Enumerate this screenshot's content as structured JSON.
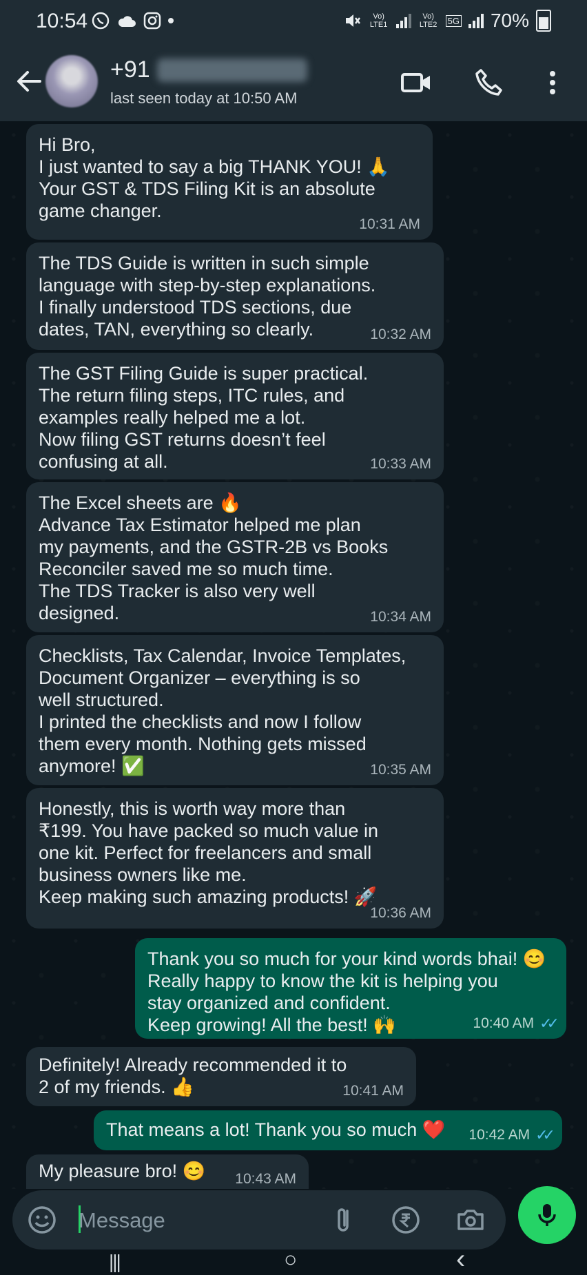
{
  "status_bar": {
    "time": "10:54",
    "battery": "70%",
    "sim1": "Vo) LTE1",
    "sim2": "Vo) LTE2",
    "network": "5G"
  },
  "header": {
    "contact_prefix": "+91",
    "last_seen": "last seen today at 10:50 AM",
    "icons": [
      "back-arrow-icon",
      "video-call-icon",
      "voice-call-icon",
      "more-options-icon"
    ]
  },
  "messages": [
    {
      "dir": "in",
      "text": "Hi Bro,\nI just wanted to say a big THANK YOU! 🙏\nYour GST & TDS Filing Kit is an absolute\ngame changer.",
      "time": "10:31 AM"
    },
    {
      "dir": "in",
      "text": "The TDS Guide is written in such simple\nlanguage with step-by-step explanations.\nI finally understood TDS sections, due\ndates, TAN, everything so clearly.",
      "time": "10:32 AM"
    },
    {
      "dir": "in",
      "text": "The GST Filing Guide is super practical.\nThe return filing steps, ITC rules, and\nexamples really helped me a lot.\nNow filing GST returns doesn’t feel\nconfusing at all.",
      "time": "10:33 AM"
    },
    {
      "dir": "in",
      "text": "The Excel sheets are 🔥\nAdvance Tax Estimator helped me plan\nmy payments, and the GSTR-2B vs Books\nReconciler saved me so much time.\nThe TDS Tracker is also very well\ndesigned.",
      "time": "10:34 AM"
    },
    {
      "dir": "in",
      "text": "Checklists, Tax Calendar, Invoice Templates,\nDocument Organizer – everything is so\nwell structured.\nI printed the checklists and now I follow\nthem every month. Nothing gets missed\nanymore! ✅",
      "time": "10:35 AM"
    },
    {
      "dir": "in",
      "text": "Honestly, this is worth way more than\n₹199. You have packed so much value in\none kit. Perfect for freelancers and small\nbusiness owners like me.\nKeep making such amazing products! 🚀",
      "time": "10:36 AM"
    },
    {
      "dir": "out",
      "text": "Thank you so much for your kind words bhai! 😊\nReally happy to know the kit is helping you\nstay organized and confident.\nKeep growing! All the best! 🙌",
      "time": "10:40 AM",
      "read": true
    },
    {
      "dir": "in",
      "text": "Definitely! Already recommended it to\n2 of my friends. 👍",
      "time": "10:41 AM"
    },
    {
      "dir": "out",
      "text": "That means a lot! Thank you so much ❤️",
      "time": "10:42 AM",
      "read": true
    },
    {
      "dir": "in",
      "text": "My pleasure bro! 😊",
      "time": "10:43 AM"
    }
  ],
  "composer": {
    "placeholder": "Message",
    "icons": [
      "emoji-icon",
      "attach-icon",
      "rupee-payment-icon",
      "camera-icon",
      "mic-icon"
    ]
  },
  "nav_bar": {
    "recents": "|||",
    "home": "○",
    "back": "‹"
  },
  "colors": {
    "background": "#0b141a",
    "header": "#1f2c34",
    "incoming_bubble": "#1f2c34",
    "outgoing_bubble": "#005c4b",
    "accent": "#25d366",
    "read_tick": "#53bdeb"
  }
}
